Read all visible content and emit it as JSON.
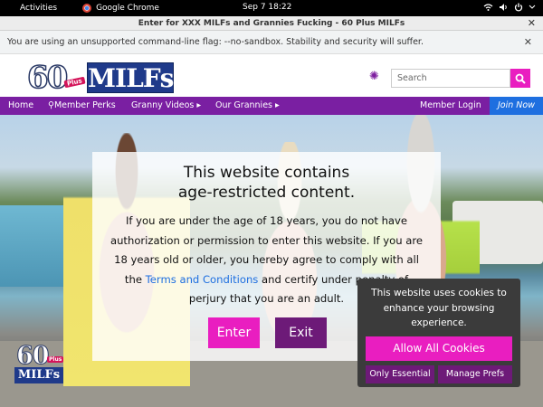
{
  "system_bar": {
    "activities": "Activities",
    "app_name": "Google Chrome",
    "clock": "Sep 7  18:22"
  },
  "window": {
    "title": "Enter for XXX MILFs and Grannies Fucking - 60 Plus MILFs"
  },
  "infobar": {
    "message": "You are using an unsupported command-line flag: --no-sandbox. Stability and security will suffer."
  },
  "header": {
    "logo": {
      "number": "60",
      "plus": "Plus",
      "brand": "MILFs"
    },
    "search_placeholder": "Search"
  },
  "nav": {
    "items": [
      "Home",
      "Member Perks",
      "Granny Videos",
      "Our Grannies"
    ],
    "member_login": "Member Login",
    "join": "Join Now"
  },
  "age_gate": {
    "title_line1": "This website contains",
    "title_line2": "age-restricted content.",
    "body_part1": "If you are under the age of 18 years, you do not have authorization or permission to enter this website. If you are 18 years old or older, you hereby agree to comply with all the",
    "terms_link": "Terms and Conditions",
    "body_part2": "and certify under penalty of perjury that you are an adult.",
    "enter_label": "Enter",
    "exit_label": "Exit"
  },
  "cookie_banner": {
    "message": "This website uses cookies to enhance your browsing experience.",
    "allow_all": "Allow All Cookies",
    "only_essential": "Only Essential",
    "manage_prefs": "Manage Prefs"
  },
  "colors": {
    "nav_purple": "#7a1fa2",
    "magenta": "#e91ec0",
    "dark_purple": "#6d1a78",
    "join_blue": "#1e6fe0"
  }
}
